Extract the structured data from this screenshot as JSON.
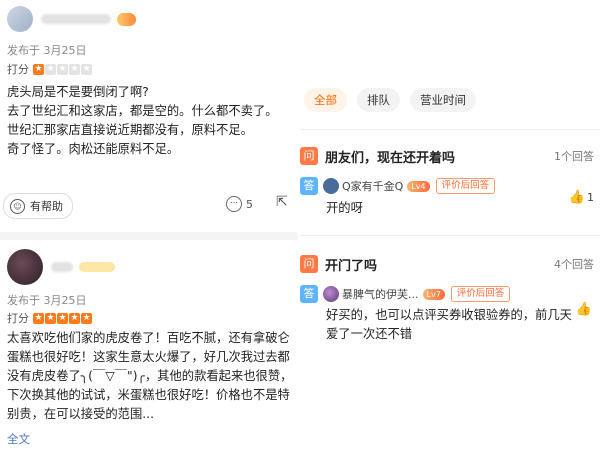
{
  "reviews": [
    {
      "published": "发布于 3月25日",
      "score_label": "打分",
      "stars": 1,
      "content": [
        "虎头局是不是要倒闭了啊?",
        "去了世纪汇和这家店，都是空的。什么都不卖了。",
        "世纪汇那家店直接说近期都没有，原料不足。",
        "奇了怪了。肉松还能原料不足。"
      ],
      "helpful_label": "有帮助",
      "comment_count": "5"
    },
    {
      "published": "发布于 3月25日",
      "score_label": "打分",
      "stars": 5,
      "content": [
        "太喜欢吃他们家的虎皮卷了！百吃不腻，还有拿破仑蛋糕也很好吃！这家生意太火爆了，好几次我过去都没有虎皮卷了╮(￣▽￣\")╭，其他的款看起来也很赞，下次换其他的试试，米蛋糕也很好吃！价格也不是特别贵，在可以接受的范围..."
      ],
      "full_text_label": "全文"
    }
  ],
  "qa": {
    "tabs": [
      {
        "label": "全部",
        "active": true
      },
      {
        "label": "排队",
        "active": false
      },
      {
        "label": "营业时间",
        "active": false
      }
    ],
    "question_tag": "问",
    "answer_tag": "答",
    "items": [
      {
        "question": "朋友们，现在还开着吗",
        "count": "1个回答",
        "answerer": "Q家有千金Q",
        "level": "Lv4",
        "badge": "评价后回答",
        "answer": "开的呀",
        "likes": "1"
      },
      {
        "question": "开门了吗",
        "count": "4个回答",
        "answerer": "暴脾气的伊芙...",
        "level": "Lv7",
        "badge": "评价后回答",
        "answer": "好买的，也可以点评买券收银验券的，前几天爱了一次还不错",
        "likes": ""
      }
    ]
  },
  "colors": {
    "accent": "#ff6a00",
    "star_on": "#ff7a1a",
    "question_tag": "#ff7a45",
    "answer_tag": "#5fb4ff",
    "link": "#4a78c2"
  }
}
